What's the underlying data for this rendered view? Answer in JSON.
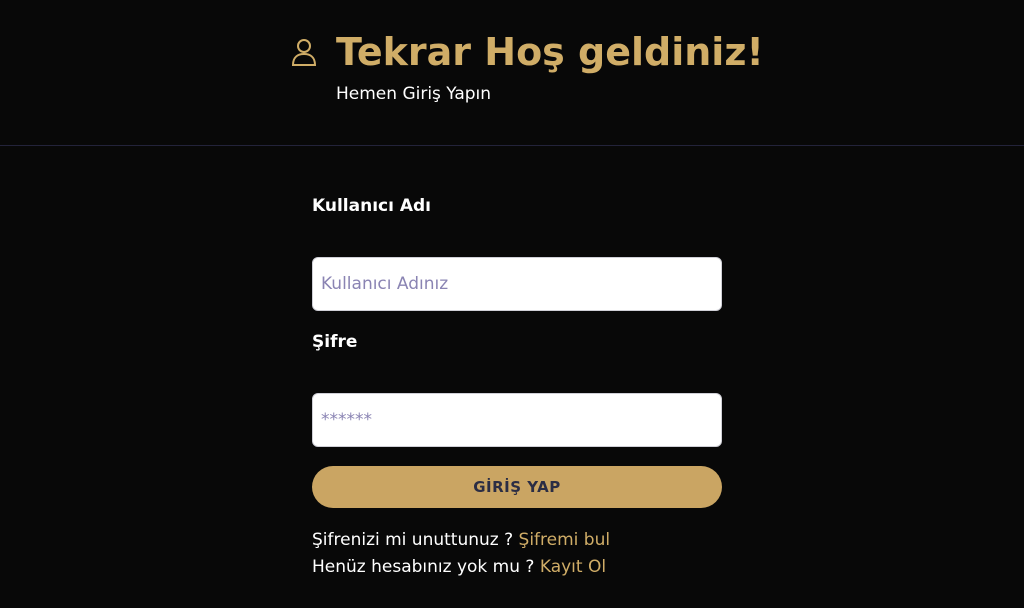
{
  "header": {
    "icon": "user-icon",
    "title": "Tekrar Hoş geldiniz!",
    "subtitle": "Hemen Giriş Yapın"
  },
  "form": {
    "username_label": "Kullanıcı Adı",
    "username_placeholder": "Kullanıcı Adınız",
    "username_value": "",
    "password_label": "Şifre",
    "password_placeholder": "******",
    "password_value": "",
    "submit_label": "GİRİŞ YAP"
  },
  "footer": {
    "forgot_text": "Şifrenizi mi unuttunuz ? ",
    "forgot_link": "Şifremi bul",
    "register_text": "Henüz hesabınız yok mu ? ",
    "register_link": "Kayıt Ol"
  },
  "colors": {
    "background": "#080808",
    "accent": "#d0ad67",
    "button": "#caa563",
    "button_text": "#2b2d44",
    "divider": "#23233a",
    "placeholder": "#8a84b3"
  }
}
